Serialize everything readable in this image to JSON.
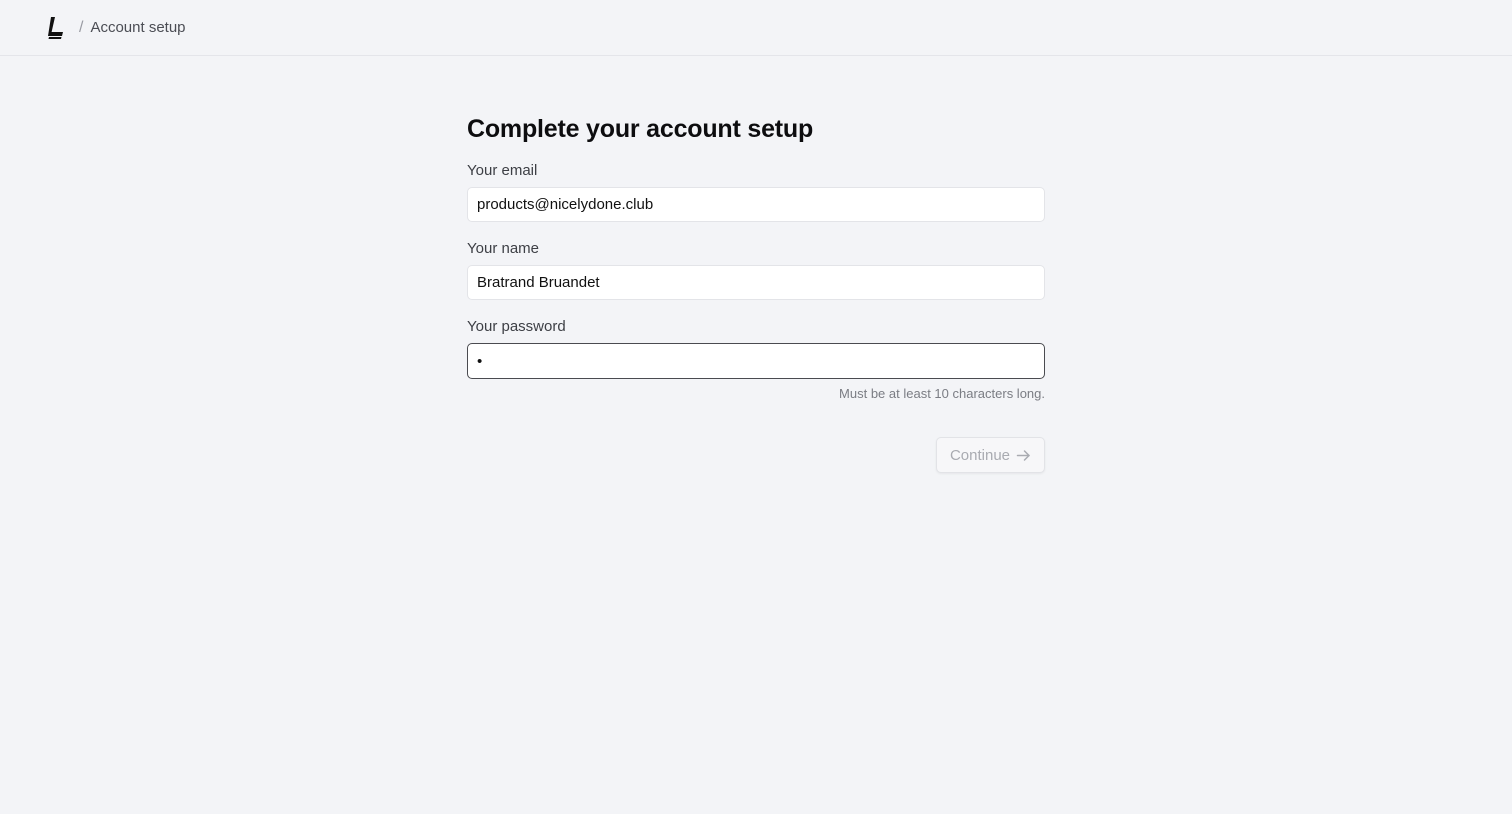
{
  "header": {
    "logo_icon": "brand-logo-icon",
    "separator": "/",
    "breadcrumb": "Account setup"
  },
  "form": {
    "title": "Complete your account setup",
    "email": {
      "label": "Your email",
      "value": "products@nicelydone.club"
    },
    "name": {
      "label": "Your name",
      "value": "Bratrand Bruandet"
    },
    "password": {
      "label": "Your password",
      "value": "•",
      "hint": "Must be at least 10 characters long."
    },
    "continue_label": "Continue",
    "continue_icon": "arrow-right-icon"
  },
  "colors": {
    "background": "#f3f4f7",
    "input_background": "#ffffff",
    "focused_border": "#4a4b50",
    "disabled_text": "#a9abb1"
  }
}
